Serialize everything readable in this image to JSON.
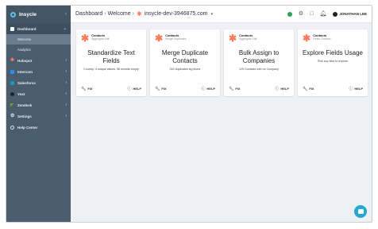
{
  "brand": {
    "title": "Insycle"
  },
  "sidebar": {
    "dashboard": {
      "label": "Dashboard"
    },
    "subitems": [
      {
        "label": "Welcome"
      },
      {
        "label": "Analytics"
      }
    ],
    "items": [
      {
        "label": "Hubspot",
        "color": "#ff7a59"
      },
      {
        "label": "Intercom",
        "color": "#2c8cf4"
      },
      {
        "label": "Salesforce",
        "color": "#1798c1"
      },
      {
        "label": "Yext",
        "color": "#333333"
      },
      {
        "label": "Zendesk",
        "color": "#78a300"
      },
      {
        "label": "Settings",
        "color": "#dfe6ec"
      },
      {
        "label": "Help Center",
        "color": "#dfe6ec"
      }
    ]
  },
  "topbar": {
    "crumb1": "Dashboard",
    "crumb2": "Welcome",
    "account": "insycle-dev-3946875.com",
    "user": "JONATHAN LEE"
  },
  "cards": [
    {
      "object": "Contacts",
      "sub": "Aggregate Edit",
      "title": "Standardize Text Fields",
      "desc": "Country: 4 unique values, 58 records empty",
      "fix": "FIX",
      "help": "HELP"
    },
    {
      "object": "Contacts",
      "sub": "Merge Duplicates",
      "title": "Merge Duplicate Contacts",
      "desc": "242 duplicates by phone",
      "fix": "FIX",
      "help": "HELP"
    },
    {
      "object": "Contacts",
      "sub": "Aggregate Edit",
      "title": "Bulk Assign to Companies",
      "desc": "129 Contacts with no Company",
      "fix": "FIX",
      "help": "HELP"
    },
    {
      "object": "Contacts",
      "sub": "Fields Cleanse",
      "title": "Explore Fields Usage",
      "desc": "Pick any field to explore",
      "fix": "FIX",
      "help": "HELP"
    }
  ],
  "colors": {
    "sidebar": "#4a5d6e",
    "accent": "#ff7a59",
    "chat": "#27a8cf"
  }
}
